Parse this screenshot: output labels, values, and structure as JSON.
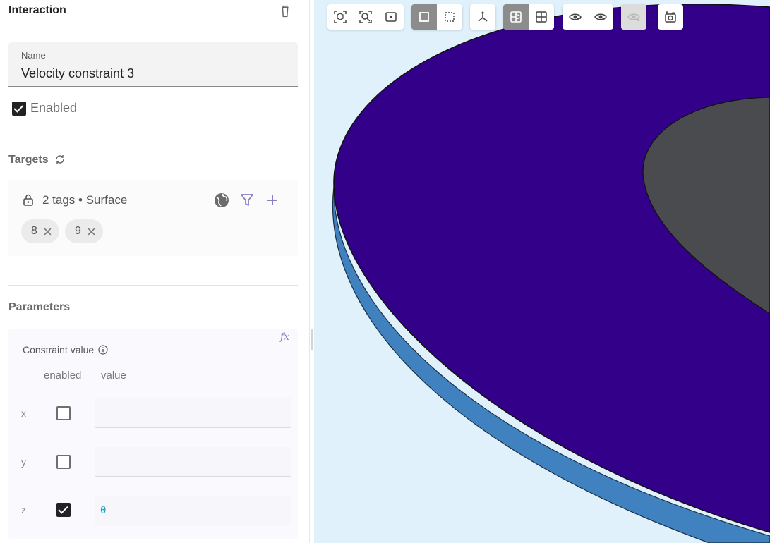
{
  "panel": {
    "title": "Interaction",
    "name_label": "Name",
    "name_value": "Velocity constraint 3",
    "enabled_label": "Enabled",
    "enabled": true
  },
  "targets": {
    "title": "Targets",
    "summary": "2 tags • Surface",
    "chips": [
      "8",
      "9"
    ]
  },
  "parameters": {
    "title": "Parameters",
    "constraint_label": "Constraint value",
    "fx_label": "fx",
    "col_enabled": "enabled",
    "col_value": "value",
    "rows": [
      {
        "axis": "x",
        "enabled": false,
        "value": ""
      },
      {
        "axis": "y",
        "enabled": false,
        "value": ""
      },
      {
        "axis": "z",
        "enabled": true,
        "value": "0"
      }
    ]
  },
  "viewport": {
    "toolbar_groups": [
      [
        "fit-selection-icon",
        "zoom-to-fit-icon",
        "zoom-region-icon"
      ],
      [
        "surface-mode-icon",
        "wireframe-mode-icon"
      ],
      [
        "axes-icon"
      ],
      [
        "section-view-icon",
        "grid-view-icon"
      ],
      [
        "hide-icon",
        "show-icon"
      ],
      [
        "visibility-disabled-icon"
      ],
      [
        "screenshot-icon"
      ]
    ],
    "colors": {
      "background": "#e0f1fc",
      "disc_top": "#33008a",
      "disc_edge": "#3f82bf",
      "inner_face": "#4a4b4f"
    }
  }
}
